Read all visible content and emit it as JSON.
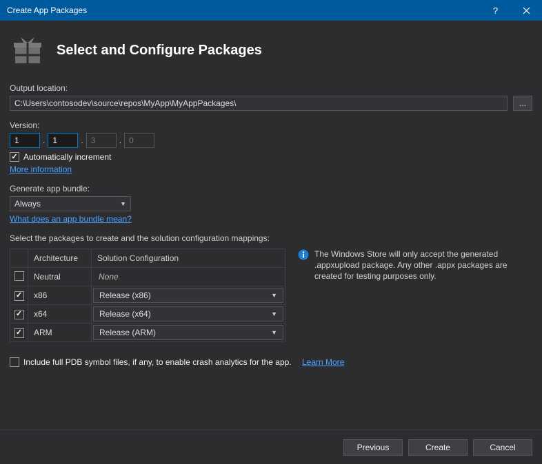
{
  "titlebar": {
    "title": "Create App Packages"
  },
  "header": {
    "heading": "Select and Configure Packages"
  },
  "output": {
    "label": "Output location:",
    "value": "C:\\Users\\contosodev\\source\\repos\\MyApp\\MyAppPackages\\",
    "browse": "..."
  },
  "version": {
    "label": "Version:",
    "parts": {
      "major": "1",
      "minor": "1",
      "build": "3",
      "revision": "0"
    },
    "auto_inc_label": "Automatically increment",
    "auto_inc_checked": true,
    "more_info": "More information"
  },
  "bundle": {
    "label": "Generate app bundle:",
    "value": "Always",
    "help": "What does an app bundle mean?"
  },
  "packages": {
    "prompt": "Select the packages to create and the solution configuration mappings:",
    "headers": {
      "arch": "Architecture",
      "conf": "Solution Configuration"
    },
    "rows": [
      {
        "checked": false,
        "arch": "Neutral",
        "conf": "None",
        "combo": false
      },
      {
        "checked": true,
        "arch": "x86",
        "conf": "Release (x86)",
        "combo": true
      },
      {
        "checked": true,
        "arch": "x64",
        "conf": "Release (x64)",
        "combo": true
      },
      {
        "checked": true,
        "arch": "ARM",
        "conf": "Release (ARM)",
        "combo": true
      }
    ],
    "info": "The Windows Store will only accept the generated .appxupload package. Any other .appx packages are created for testing purposes only."
  },
  "pdb": {
    "checked": false,
    "label": "Include full PDB symbol files, if any, to enable crash analytics for the app.",
    "learn_more": "Learn More"
  },
  "footer": {
    "previous": "Previous",
    "create": "Create",
    "cancel": "Cancel"
  }
}
